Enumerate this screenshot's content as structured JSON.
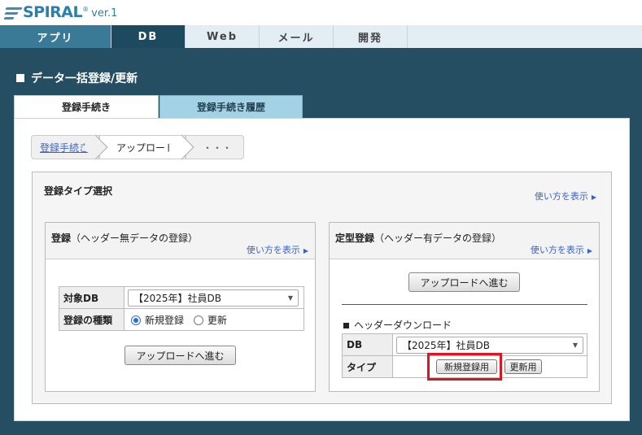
{
  "brand": {
    "name": "SPIRAL",
    "mark": "®",
    "version": "ver.1",
    "color": "#2b7fab"
  },
  "nav": [
    {
      "label": "アプリ"
    },
    {
      "label": "DB"
    },
    {
      "label": "Web"
    },
    {
      "label": "メール"
    },
    {
      "label": "開発"
    }
  ],
  "page": {
    "title": "データ一括登録/更新"
  },
  "tabs": [
    {
      "label": "登録手続き",
      "active": true
    },
    {
      "label": "登録手続き履歴",
      "active": false
    }
  ],
  "breadcrumb": {
    "step1": "登録手続き",
    "step2": "アップロード",
    "step3": "・・・"
  },
  "type_panel": {
    "title": "登録タイプ選択",
    "howto": "使い方を表示"
  },
  "register_box": {
    "title": "登録",
    "note": "（ヘッダー無データの登録）",
    "howto": "使い方を表示",
    "db_label": "対象DB",
    "db_value": "【2025年】社員DB",
    "kind_label": "登録の種類",
    "radio_new": "新規登録",
    "radio_update": "更新",
    "upload_button": "アップロードへ進む"
  },
  "fixed_box": {
    "title": "定型登録",
    "note": "（ヘッダー有データの登録）",
    "howto": "使い方を表示",
    "upload_button": "アップロードへ進む",
    "download_title": "ヘッダーダウンロード",
    "db_label": "DB",
    "db_value": "【2025年】社員DB",
    "type_label": "タイプ",
    "new_button": "新規登録用",
    "update_button": "更新用"
  },
  "colors": {
    "nav_active": "#1d4a5f",
    "nav_app": "#3b7a97",
    "main_bg": "#254e62",
    "link": "#3a63c8",
    "highlight": "#e0141f"
  }
}
